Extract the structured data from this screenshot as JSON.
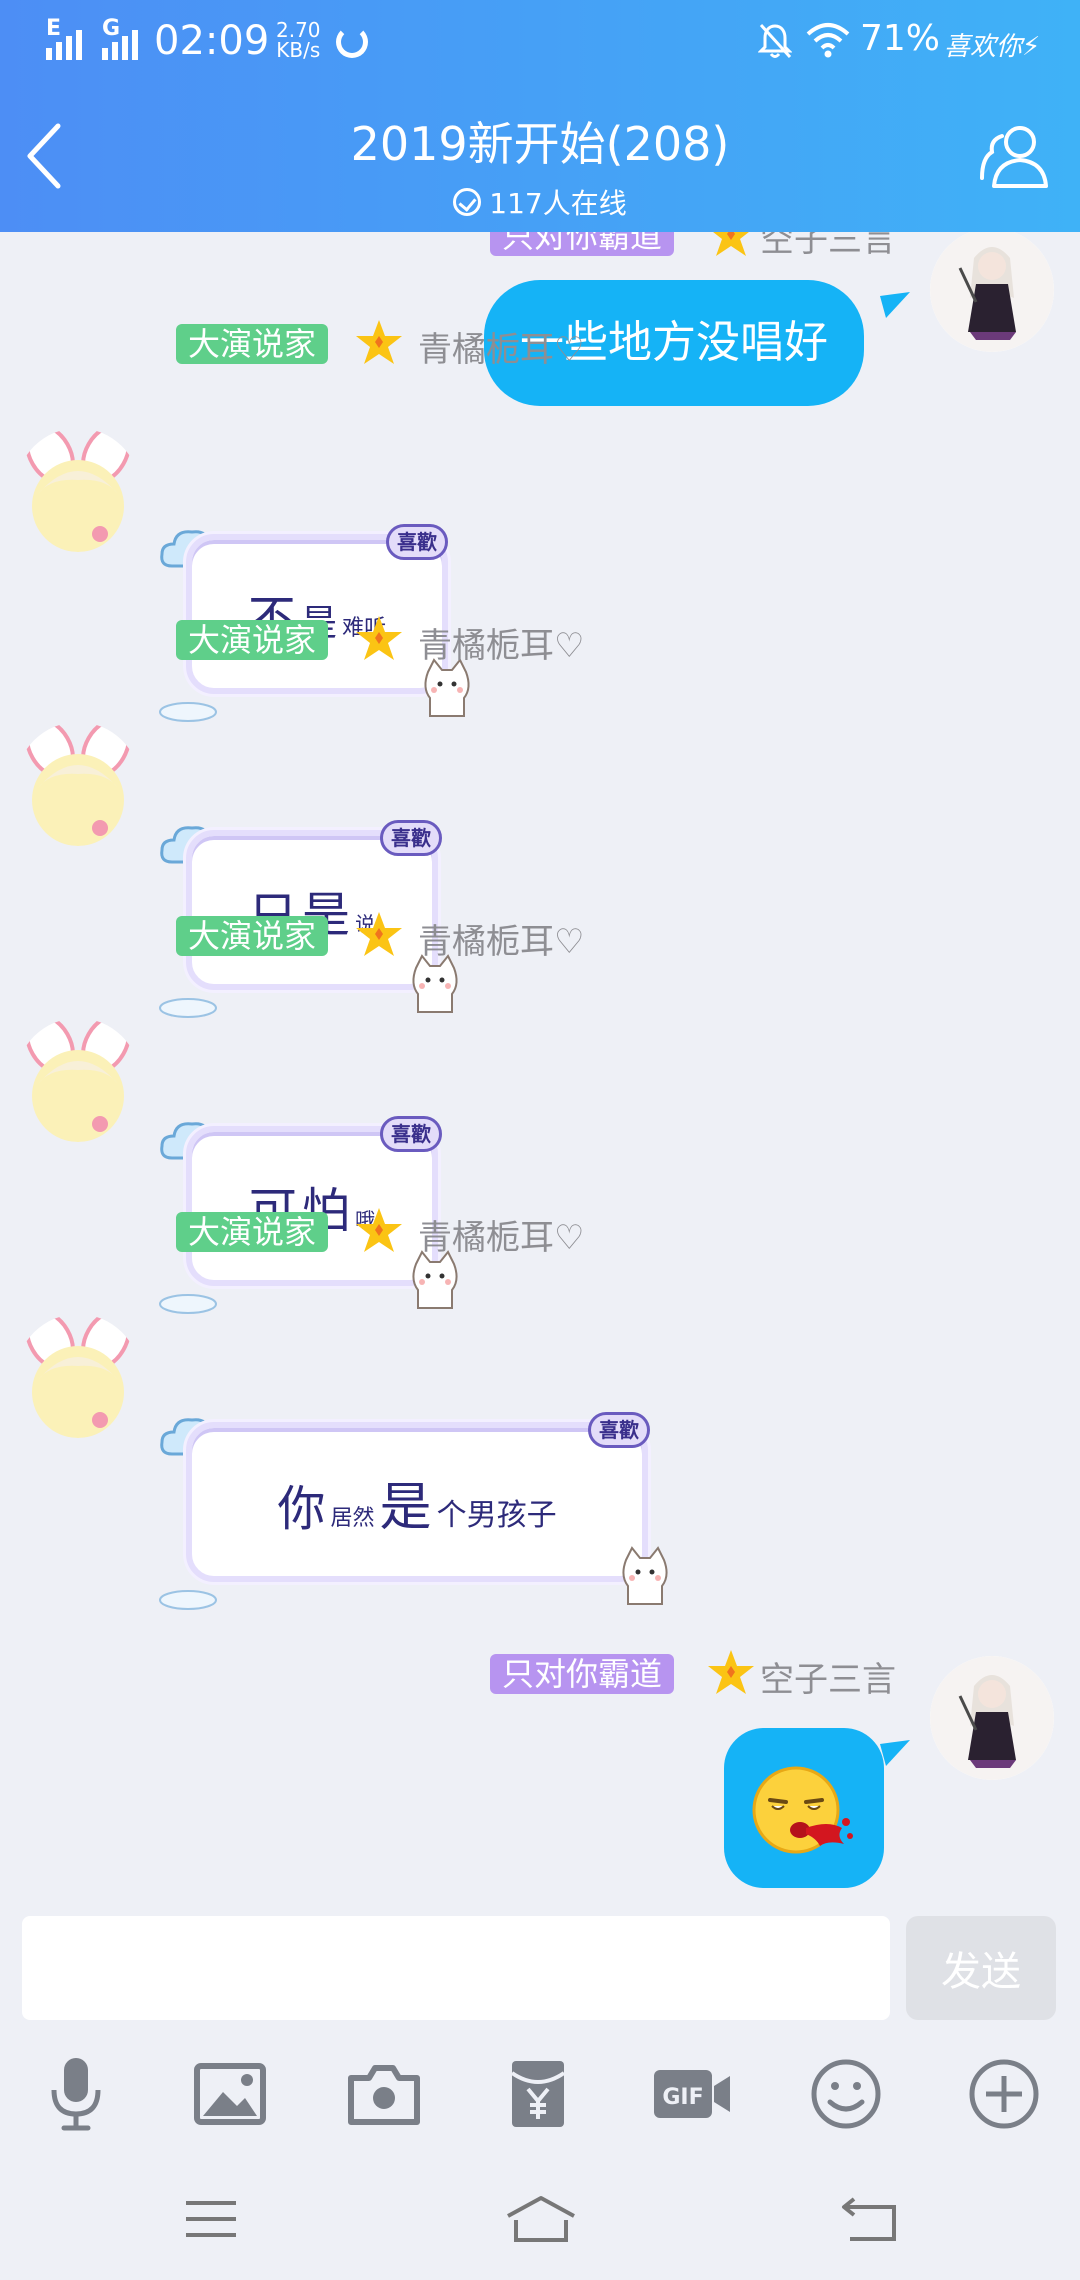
{
  "status_bar": {
    "net1": "E",
    "net2": "G",
    "time": "02:09",
    "speed_value": "2.70",
    "speed_unit": "KB/s",
    "battery": "71%",
    "custom_text": "喜欢你⚡"
  },
  "header": {
    "title": "2019新开始(208)",
    "online": "117人在线"
  },
  "messages": [
    {
      "sender": "self",
      "badge": "只对你霸道",
      "name": "空子三言",
      "text": "一些地方没唱好"
    },
    {
      "sender": "other",
      "badge": "大演说家",
      "name": "青橘栀耳♡",
      "sticker_text": [
        "不",
        "是",
        "难听"
      ],
      "sticker_tag": "喜歡"
    },
    {
      "sender": "other",
      "badge": "大演说家",
      "name": "青橘栀耳♡",
      "sticker_text": [
        "只",
        "是",
        "说"
      ],
      "sticker_tag": "喜歡"
    },
    {
      "sender": "other",
      "badge": "大演说家",
      "name": "青橘栀耳♡",
      "sticker_text": [
        "可",
        "怕",
        "哦"
      ],
      "sticker_tag": "喜歡"
    },
    {
      "sender": "other",
      "badge": "大演说家",
      "name": "青橘栀耳♡",
      "sticker_text": [
        "你",
        "居然",
        "是",
        "个男孩子"
      ],
      "sticker_tag": "喜歡"
    },
    {
      "sender": "self",
      "badge": "只对你霸道",
      "name": "空子三言",
      "emoji": "spitting-blood-emoji"
    }
  ],
  "input": {
    "value": "",
    "send_label": "发送"
  },
  "toolbar_icons": [
    "microphone-icon",
    "image-icon",
    "camera-icon",
    "red-packet-icon",
    "gif-icon",
    "emoji-icon",
    "plus-icon"
  ],
  "colors": {
    "header_start": "#4d8ef5",
    "header_end": "#3fb2f7",
    "self_bubble": "#15b3f6",
    "badge_green": "#5fcf8a",
    "badge_purple": "#b794f0",
    "background": "#eef0f6"
  }
}
